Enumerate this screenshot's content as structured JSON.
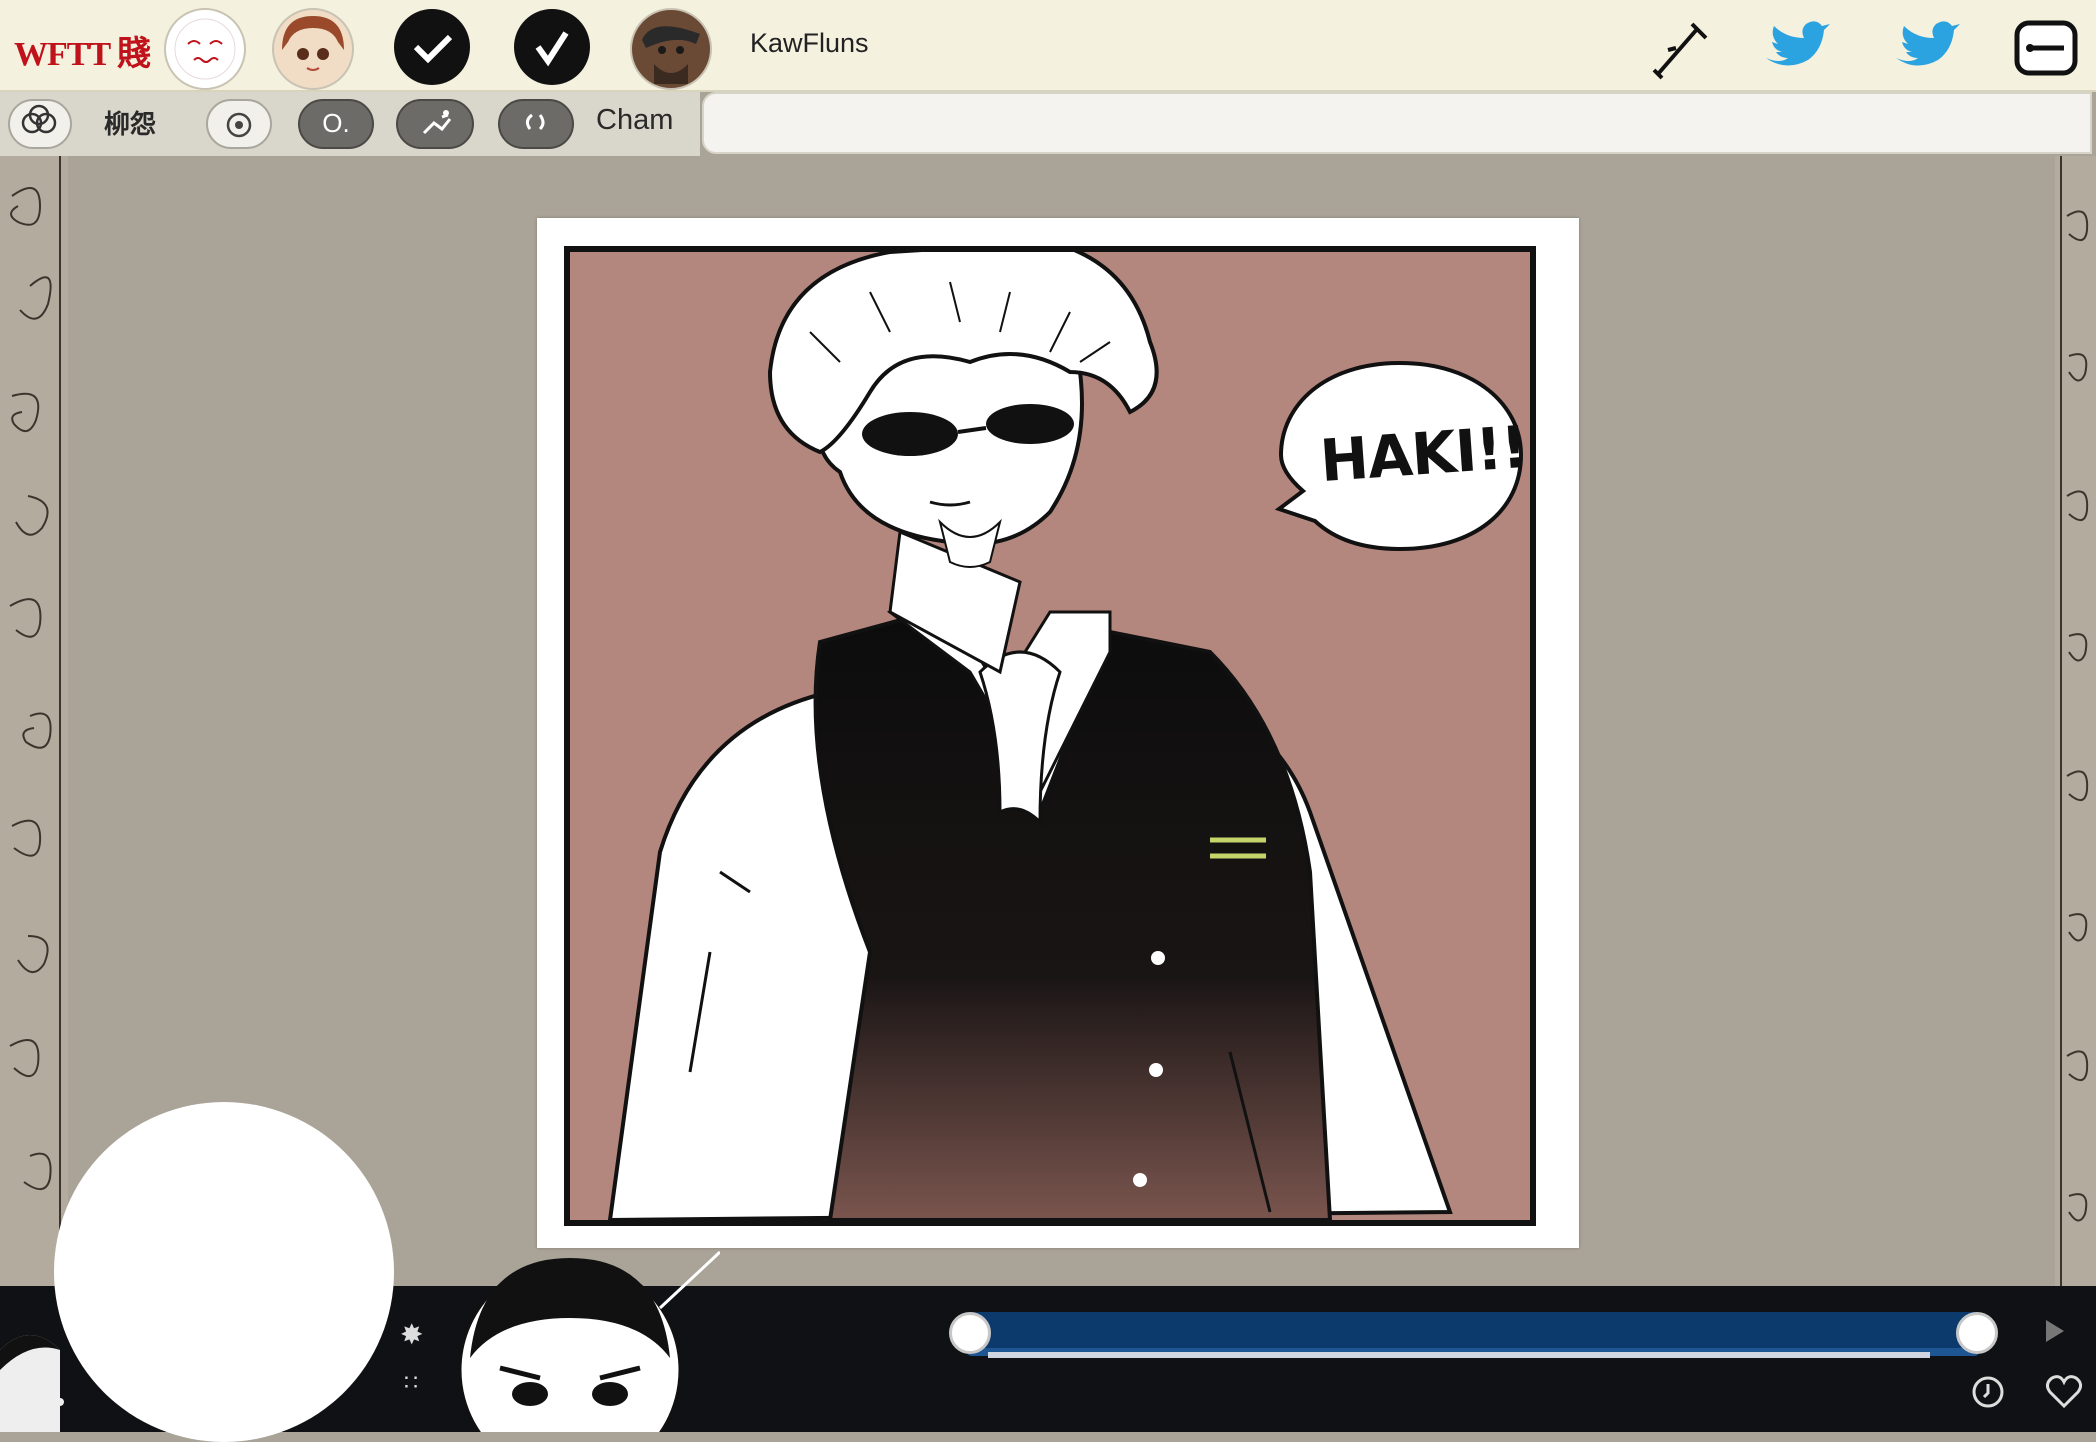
{
  "app": {
    "logo_text": "WFTT 賤"
  },
  "topbar": {
    "username": "KawFluns",
    "avatars": [
      "face-sketch-avatar",
      "anime-girl-avatar",
      "bearded-man-avatar"
    ],
    "icons": [
      "check-icon",
      "check-icon",
      "sword-icon",
      "bird-icon",
      "bird-icon",
      "minus-icon"
    ]
  },
  "secondary_bar": {
    "label_1": "柳怨",
    "pill_1": "O.",
    "tab_label": "Cham",
    "url_value": ""
  },
  "comic": {
    "speech": "HAKI!!"
  },
  "player": {
    "progress": 1.0,
    "accent_color": "#0d3a6c"
  },
  "colors": {
    "panel_bg": "#b4877e",
    "logo": "#c0121a",
    "bar": "#101114"
  }
}
